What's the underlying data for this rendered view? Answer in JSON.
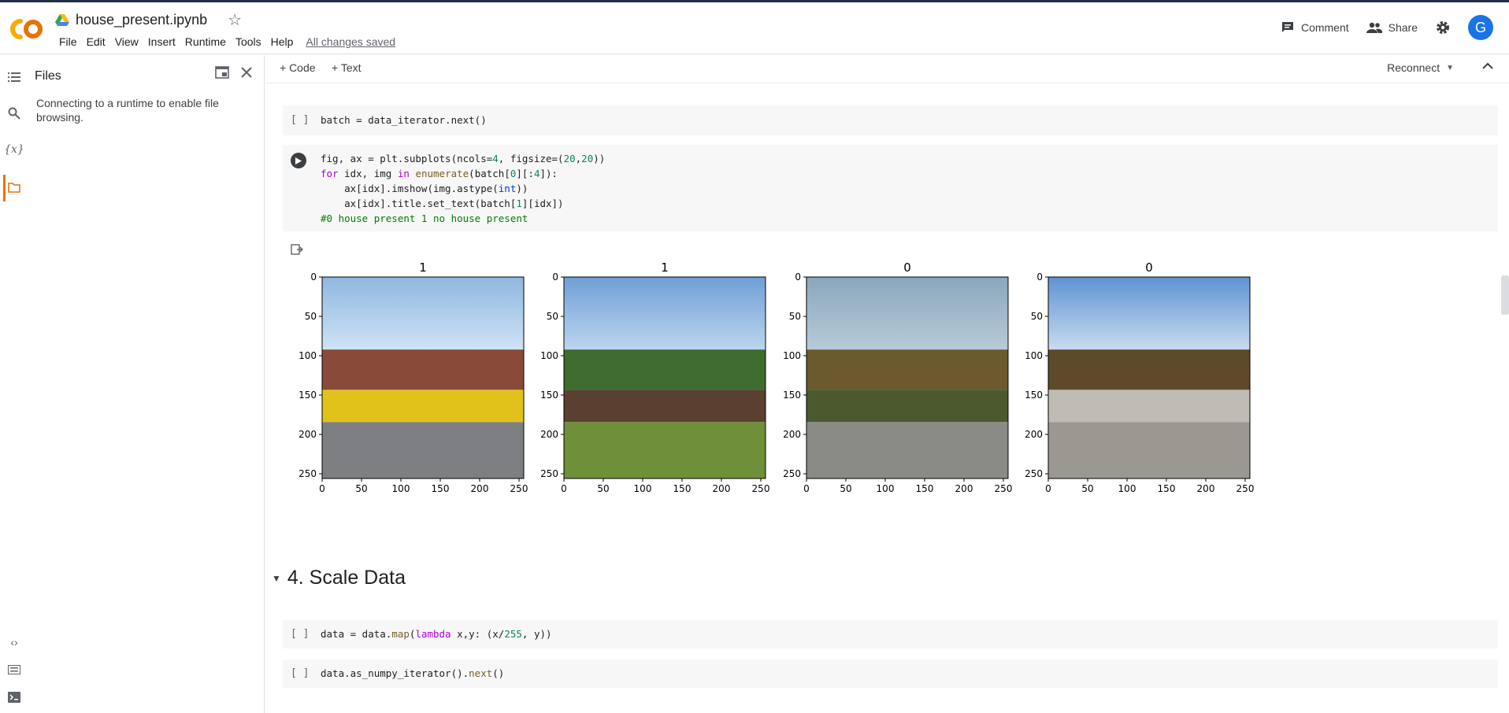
{
  "header": {
    "notebook_title": "house_present.ipynb",
    "menu": [
      "File",
      "Edit",
      "View",
      "Insert",
      "Runtime",
      "Tools",
      "Help"
    ],
    "saved_status": "All changes saved",
    "comment_label": "Comment",
    "share_label": "Share",
    "avatar_letter": "G"
  },
  "files_panel": {
    "title": "Files",
    "message": "Connecting to a runtime to enable file browsing."
  },
  "toolbar": {
    "code_label": "+ Code",
    "text_label": "+ Text",
    "reconnect_label": "Reconnect"
  },
  "cells": {
    "bracket": "[ ]",
    "batch_code": "batch = data_iterator.next()",
    "scale_code": "data = data.map(lambda x,y: (x/255, y))",
    "numpy_code": "data.as_numpy_iterator().next()"
  },
  "section": {
    "title": "4. Scale Data"
  },
  "chart_data": [
    {
      "type": "image",
      "title": "1",
      "xticks": [
        "0",
        "50",
        "100",
        "150",
        "200",
        "250"
      ],
      "yticks": [
        "0",
        "50",
        "100",
        "150",
        "200",
        "250"
      ]
    },
    {
      "type": "image",
      "title": "1",
      "xticks": [
        "0",
        "50",
        "100",
        "150",
        "200",
        "250"
      ],
      "yticks": [
        "0",
        "50",
        "100",
        "150",
        "200",
        "250"
      ]
    },
    {
      "type": "image",
      "title": "0",
      "xticks": [
        "0",
        "50",
        "100",
        "150",
        "200",
        "250"
      ],
      "yticks": [
        "0",
        "50",
        "100",
        "150",
        "200",
        "250"
      ]
    },
    {
      "type": "image",
      "title": "0",
      "xticks": [
        "0",
        "50",
        "100",
        "150",
        "200",
        "250"
      ],
      "yticks": [
        "0",
        "50",
        "100",
        "150",
        "200",
        "250"
      ]
    }
  ],
  "colors": {
    "accent": "#e8710a",
    "avatar": "#1a73e8",
    "cell_bg": "#f7f7f7"
  }
}
